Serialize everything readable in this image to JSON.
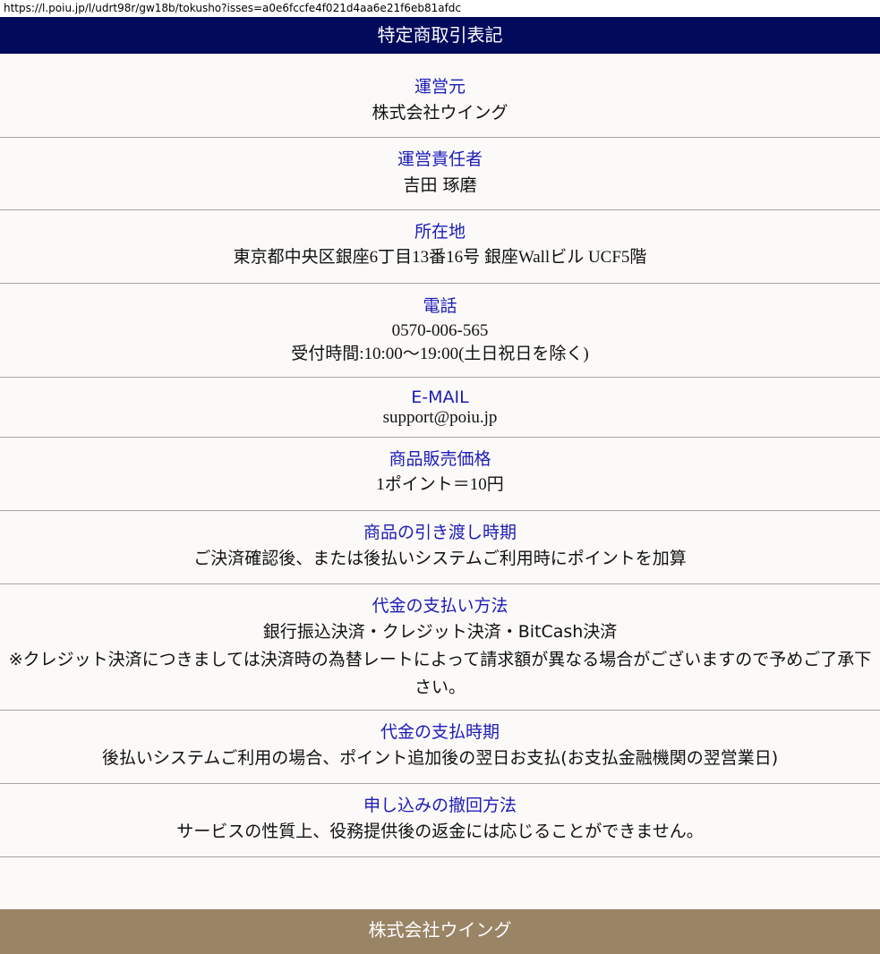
{
  "url": "https://l.poiu.jp/l/udrt98r/gw18b/tokusho?isses=a0e6fccfe4f021d4aa6e21f6eb81afdc",
  "header": {
    "title": "特定商取引表記"
  },
  "sections": [
    {
      "label": "運営元",
      "lines": [
        "株式会社ウイング"
      ]
    },
    {
      "label": "運営責任者",
      "lines": [
        "吉田 琢磨"
      ]
    },
    {
      "label": "所在地",
      "lines": [
        "東京都中央区銀座6丁目13番16号 銀座Wallビル UCF5階"
      ]
    },
    {
      "label": "電話",
      "lines": [
        "0570-006-565",
        "受付時間:10:00～19:00(土日祝日を除く)"
      ]
    },
    {
      "label": "E-MAIL",
      "lines": [
        "support@poiu.jp"
      ]
    },
    {
      "label": "商品販売価格",
      "lines": [
        "1ポイント＝10円"
      ]
    },
    {
      "label": "商品の引き渡し時期",
      "lines": [
        "ご決済確認後、または後払いシステムご利用時にポイントを加算"
      ]
    },
    {
      "label": "代金の支払い方法",
      "lines": [
        "銀行振込決済・クレジット決済・BitCash決済",
        "※クレジット決済につきましては決済時の為替レートによって請求額が異なる場合がございますので予めご了承下さい。"
      ]
    },
    {
      "label": "代金の支払時期",
      "lines": [
        "後払いシステムご利用の場合、ポイント追加後の翌日お支払(お支払金融機関の翌営業日)"
      ]
    },
    {
      "label": "申し込みの撤回方法",
      "lines": [
        "サービスの性質上、役務提供後の返金には応じることができません。"
      ]
    }
  ],
  "footer": {
    "text": "株式会社ウイング"
  }
}
